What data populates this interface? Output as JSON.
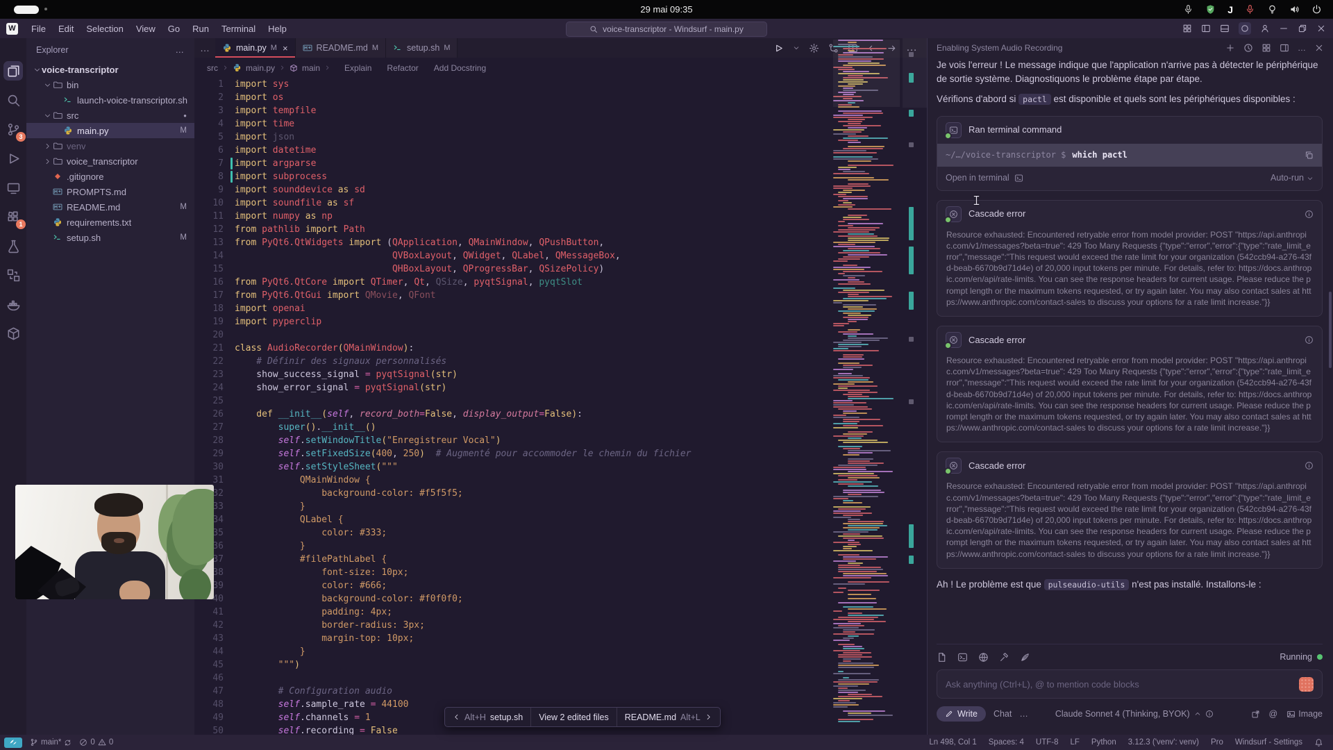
{
  "system_bar": {
    "clock": "29 mai 09:35",
    "tray_icons": [
      "mic",
      "shield",
      "jetbrains",
      "mic-recording",
      "bulb",
      "speaker",
      "power"
    ]
  },
  "menu_bar": {
    "logo": "W",
    "menus": [
      "File",
      "Edit",
      "Selection",
      "View",
      "Go",
      "Run",
      "Terminal",
      "Help"
    ],
    "search_title": "voice-transcriptor - Windsurf - main.py",
    "window_controls": [
      "grid",
      "panel-left",
      "panel-bottom",
      "circle",
      "account",
      "minimize",
      "restore",
      "close"
    ]
  },
  "activity_bar": {
    "items": [
      {
        "icon": "files",
        "active": true
      },
      {
        "icon": "search"
      },
      {
        "icon": "scm",
        "badge": "3"
      },
      {
        "icon": "debug"
      },
      {
        "icon": "devices"
      },
      {
        "icon": "extensions",
        "badge": "1"
      },
      {
        "icon": "flask"
      },
      {
        "icon": "boxes"
      },
      {
        "icon": "docker"
      },
      {
        "icon": "cube"
      }
    ]
  },
  "explorer": {
    "title": "Explorer",
    "items": [
      {
        "label": "voice-transcriptor",
        "level": 0,
        "chevron": "down",
        "root": true
      },
      {
        "label": "bin",
        "level": 1,
        "chevron": "down",
        "icon": "folder"
      },
      {
        "label": "launch-voice-transcriptor.sh",
        "level": 2,
        "icon": "shell"
      },
      {
        "label": "src",
        "level": 1,
        "chevron": "down",
        "icon": "folder",
        "badge": "dot"
      },
      {
        "label": "main.py",
        "level": 2,
        "icon": "python",
        "badge": "M",
        "selected": true
      },
      {
        "label": "venv",
        "level": 1,
        "chevron": "right",
        "icon": "folder",
        "dim": true
      },
      {
        "label": "voice_transcriptor",
        "level": 1,
        "chevron": "right",
        "icon": "folder"
      },
      {
        "label": ".gitignore",
        "level": 1,
        "icon": "git"
      },
      {
        "label": "PROMPTS.md",
        "level": 1,
        "icon": "markdown"
      },
      {
        "label": "README.md",
        "level": 1,
        "icon": "markdown",
        "badge": "M"
      },
      {
        "label": "requirements.txt",
        "level": 1,
        "icon": "python"
      },
      {
        "label": "setup.sh",
        "level": 1,
        "icon": "shell",
        "badge": "M"
      }
    ]
  },
  "tabs": [
    {
      "label": "main.py",
      "badge": "M",
      "icon": "python",
      "active": true,
      "closable": true
    },
    {
      "label": "README.md",
      "badge": "M",
      "icon": "markdown"
    },
    {
      "label": "setup.sh",
      "badge": "M",
      "icon": "shell"
    }
  ],
  "editor_actions": [
    "play",
    "chevdown",
    "gear",
    "diff",
    "split",
    "arrowl",
    "arrowr",
    "more"
  ],
  "breadcrumb": {
    "path": [
      "src",
      "main.py",
      "main"
    ],
    "actions": [
      "Explain",
      "Refactor",
      "Add Docstring"
    ]
  },
  "edited_files_bar": {
    "prev_shortcut": "Alt+H",
    "prev_file": "setup.sh",
    "center": "View 2 edited files",
    "next_file": "README.md",
    "next_shortcut": "Alt+L"
  },
  "editor": {
    "modified_lines": [
      7,
      8
    ],
    "lines": [
      {
        "n": 1,
        "s": [
          [
            "k",
            "import "
          ],
          [
            "m",
            "sys"
          ]
        ]
      },
      {
        "n": 2,
        "s": [
          [
            "k",
            "import "
          ],
          [
            "m",
            "os"
          ]
        ]
      },
      {
        "n": 3,
        "s": [
          [
            "k",
            "import "
          ],
          [
            "m",
            "tempfile"
          ]
        ]
      },
      {
        "n": 4,
        "s": [
          [
            "k",
            "import "
          ],
          [
            "m",
            "time"
          ]
        ]
      },
      {
        "n": 5,
        "s": [
          [
            "k",
            "import "
          ],
          [
            "d",
            "json"
          ]
        ]
      },
      {
        "n": 6,
        "s": [
          [
            "k",
            "import "
          ],
          [
            "m",
            "datetime"
          ]
        ]
      },
      {
        "n": 7,
        "s": [
          [
            "k",
            "import "
          ],
          [
            "m",
            "argparse"
          ]
        ]
      },
      {
        "n": 8,
        "s": [
          [
            "k",
            "import "
          ],
          [
            "m",
            "subprocess"
          ]
        ]
      },
      {
        "n": 9,
        "s": [
          [
            "k",
            "import "
          ],
          [
            "m",
            "sounddevice"
          ],
          [
            "k",
            " as "
          ],
          [
            "m",
            "sd"
          ]
        ]
      },
      {
        "n": 10,
        "s": [
          [
            "k",
            "import "
          ],
          [
            "m",
            "soundfile"
          ],
          [
            "k",
            " as "
          ],
          [
            "m",
            "sf"
          ]
        ]
      },
      {
        "n": 11,
        "s": [
          [
            "k",
            "import "
          ],
          [
            "m",
            "numpy"
          ],
          [
            "k",
            " as "
          ],
          [
            "m",
            "np"
          ]
        ]
      },
      {
        "n": 12,
        "s": [
          [
            "k",
            "from "
          ],
          [
            "m",
            "pathlib"
          ],
          [
            "k",
            " import "
          ],
          [
            "m",
            "Path"
          ]
        ]
      },
      {
        "n": 13,
        "s": [
          [
            "k",
            "from "
          ],
          [
            "m",
            "PyQt6.QtWidgets"
          ],
          [
            "k",
            " import "
          ],
          [
            "w",
            "("
          ],
          [
            "m",
            "QApplication"
          ],
          [
            "w",
            ", "
          ],
          [
            "m",
            "QMainWindow"
          ],
          [
            "w",
            ", "
          ],
          [
            "m",
            "QPushButton"
          ],
          [
            "w",
            ","
          ]
        ]
      },
      {
        "n": 14,
        "s": [
          [
            "w",
            "                             "
          ],
          [
            "m",
            "QVBoxLayout"
          ],
          [
            "w",
            ", "
          ],
          [
            "m",
            "QWidget"
          ],
          [
            "w",
            ", "
          ],
          [
            "m",
            "QLabel"
          ],
          [
            "w",
            ", "
          ],
          [
            "m",
            "QMessageBox"
          ],
          [
            "w",
            ","
          ]
        ]
      },
      {
        "n": 15,
        "s": [
          [
            "w",
            "                             "
          ],
          [
            "m",
            "QHBoxLayout"
          ],
          [
            "w",
            ", "
          ],
          [
            "m",
            "QProgressBar"
          ],
          [
            "w",
            ", "
          ],
          [
            "m",
            "QSizePolicy"
          ],
          [
            "w",
            ")"
          ]
        ]
      },
      {
        "n": 16,
        "s": [
          [
            "k",
            "from "
          ],
          [
            "m",
            "PyQt6.QtCore"
          ],
          [
            "k",
            " import "
          ],
          [
            "m",
            "QTimer"
          ],
          [
            "w",
            ", "
          ],
          [
            "m",
            "Qt"
          ],
          [
            "w",
            ", "
          ],
          [
            "d",
            "QSize"
          ],
          [
            "w",
            ", "
          ],
          [
            "m",
            "pyqtSignal"
          ],
          [
            "w",
            ", "
          ],
          [
            "dt",
            "pyqtSlot"
          ]
        ]
      },
      {
        "n": 17,
        "s": [
          [
            "k",
            "from "
          ],
          [
            "m",
            "PyQt6.QtGui"
          ],
          [
            "k",
            " import "
          ],
          [
            "dr",
            "QMovie"
          ],
          [
            "w",
            ", "
          ],
          [
            "dr",
            "QFont"
          ]
        ]
      },
      {
        "n": 18,
        "s": [
          [
            "k",
            "import "
          ],
          [
            "m",
            "openai"
          ]
        ]
      },
      {
        "n": 19,
        "s": [
          [
            "k",
            "import "
          ],
          [
            "m",
            "pyperclip"
          ]
        ]
      },
      {
        "n": 20,
        "s": []
      },
      {
        "n": 21,
        "s": [
          [
            "k",
            "class "
          ],
          [
            "m",
            "AudioRecorder"
          ],
          [
            "b",
            "("
          ],
          [
            "m",
            "QMainWindow"
          ],
          [
            "b",
            ")"
          ],
          [
            "w",
            ":"
          ]
        ]
      },
      {
        "n": 22,
        "s": [
          [
            "c",
            "    # Définir des signaux personnalisés"
          ]
        ]
      },
      {
        "n": 23,
        "s": [
          [
            "v",
            "    show_success_signal "
          ],
          [
            "o",
            "= "
          ],
          [
            "m",
            "pyqtSignal"
          ],
          [
            "b",
            "("
          ],
          [
            "y",
            "str"
          ],
          [
            "b",
            ")"
          ]
        ]
      },
      {
        "n": 24,
        "s": [
          [
            "v",
            "    show_error_signal "
          ],
          [
            "o",
            "= "
          ],
          [
            "m",
            "pyqtSignal"
          ],
          [
            "b",
            "("
          ],
          [
            "y",
            "str"
          ],
          [
            "b",
            ")"
          ]
        ]
      },
      {
        "n": 25,
        "s": []
      },
      {
        "n": 26,
        "s": [
          [
            "k",
            "    def "
          ],
          [
            "f",
            "__init__"
          ],
          [
            "b",
            "("
          ],
          [
            "sf",
            "self"
          ],
          [
            "w",
            ", "
          ],
          [
            "p",
            "record_both"
          ],
          [
            "o",
            "="
          ],
          [
            "y",
            "False"
          ],
          [
            "w",
            ", "
          ],
          [
            "p",
            "display_output"
          ],
          [
            "o",
            "="
          ],
          [
            "y",
            "False"
          ],
          [
            "b",
            ")"
          ],
          [
            "w",
            ":"
          ]
        ]
      },
      {
        "n": 27,
        "s": [
          [
            "w",
            "        "
          ],
          [
            "f",
            "super"
          ],
          [
            "b",
            "()"
          ],
          [
            "w",
            "."
          ],
          [
            "f",
            "__init__"
          ],
          [
            "b",
            "()"
          ]
        ]
      },
      {
        "n": 28,
        "s": [
          [
            "w",
            "        "
          ],
          [
            "sf",
            "self"
          ],
          [
            "w",
            "."
          ],
          [
            "f",
            "setWindowTitle"
          ],
          [
            "b",
            "("
          ],
          [
            "s",
            "\"Enregistreur Vocal\""
          ],
          [
            "b",
            ")"
          ]
        ]
      },
      {
        "n": 29,
        "s": [
          [
            "w",
            "        "
          ],
          [
            "sf",
            "self"
          ],
          [
            "w",
            "."
          ],
          [
            "f",
            "setFixedSize"
          ],
          [
            "b",
            "("
          ],
          [
            "n",
            "400"
          ],
          [
            "w",
            ", "
          ],
          [
            "n",
            "250"
          ],
          [
            "b",
            ")"
          ],
          [
            "c",
            "  # Augmenté pour accommoder le chemin du fichier"
          ]
        ]
      },
      {
        "n": 30,
        "s": [
          [
            "w",
            "        "
          ],
          [
            "sf",
            "self"
          ],
          [
            "w",
            "."
          ],
          [
            "f",
            "setStyleSheet"
          ],
          [
            "b",
            "("
          ],
          [
            "s",
            "\"\"\""
          ]
        ]
      },
      {
        "n": 31,
        "s": [
          [
            "s",
            "            QMainWindow {"
          ]
        ]
      },
      {
        "n": 32,
        "s": [
          [
            "s",
            "                background-color: #f5f5f5;"
          ]
        ]
      },
      {
        "n": 33,
        "s": [
          [
            "s",
            "            }"
          ]
        ]
      },
      {
        "n": 34,
        "s": [
          [
            "s",
            "            QLabel {"
          ]
        ]
      },
      {
        "n": 35,
        "s": [
          [
            "s",
            "                color: #333;"
          ]
        ]
      },
      {
        "n": 36,
        "s": [
          [
            "s",
            "            }"
          ]
        ]
      },
      {
        "n": 37,
        "s": [
          [
            "s",
            "            #filePathLabel {"
          ]
        ]
      },
      {
        "n": 38,
        "s": [
          [
            "s",
            "                font-size: 10px;"
          ]
        ]
      },
      {
        "n": 39,
        "s": [
          [
            "s",
            "                color: #666;"
          ]
        ]
      },
      {
        "n": 40,
        "s": [
          [
            "s",
            "                background-color: #f0f0f0;"
          ]
        ]
      },
      {
        "n": 41,
        "s": [
          [
            "s",
            "                padding: 4px;"
          ]
        ]
      },
      {
        "n": 42,
        "s": [
          [
            "s",
            "                border-radius: 3px;"
          ]
        ]
      },
      {
        "n": 43,
        "s": [
          [
            "s",
            "                margin-top: 10px;"
          ]
        ]
      },
      {
        "n": 44,
        "s": [
          [
            "s",
            "            }"
          ]
        ]
      },
      {
        "n": 45,
        "s": [
          [
            "s",
            "        \"\"\""
          ],
          [
            "b",
            ")"
          ]
        ]
      },
      {
        "n": 46,
        "s": []
      },
      {
        "n": 47,
        "s": [
          [
            "c",
            "        # Configuration audio"
          ]
        ]
      },
      {
        "n": 48,
        "s": [
          [
            "w",
            "        "
          ],
          [
            "sf",
            "self"
          ],
          [
            "w",
            "."
          ],
          [
            "v",
            "sample_rate"
          ],
          [
            "o",
            " = "
          ],
          [
            "n",
            "44100"
          ]
        ]
      },
      {
        "n": 49,
        "s": [
          [
            "w",
            "        "
          ],
          [
            "sf",
            "self"
          ],
          [
            "w",
            "."
          ],
          [
            "v",
            "channels"
          ],
          [
            "o",
            " = "
          ],
          [
            "n",
            "1"
          ]
        ]
      },
      {
        "n": 50,
        "s": [
          [
            "w",
            "        "
          ],
          [
            "sf",
            "self"
          ],
          [
            "w",
            "."
          ],
          [
            "v",
            "recording"
          ],
          [
            "o",
            " = "
          ],
          [
            "y",
            "False"
          ]
        ]
      }
    ]
  },
  "cascade": {
    "title": "Enabling System Audio Recording",
    "intro_1": "Je vois l'erreur ! Le message indique que l'application n'arrive pas à détecter le périphérique de sortie système. Diagnostiquons le problème étape par étape.",
    "intro_2_pre": "Vérifions d'abord si ",
    "intro_2_code": "pactl",
    "intro_2_post": " est disponible et quels sont les périphériques disponibles :",
    "command_card": {
      "title": "Ran terminal command",
      "prompt": "~/…/voice-transcriptor $",
      "command": "which pactl",
      "open_label": "Open in terminal",
      "autorun_label": "Auto-run"
    },
    "error_card_title": "Cascade error",
    "error_card_count": 3,
    "error_text": "Resource exhausted: Encountered retryable error from model provider: POST \"https://api.anthropic.com/v1/messages?beta=true\": 429 Too Many Requests {\"type\":\"error\",\"error\":{\"type\":\"rate_limit_error\",\"message\":\"This request would exceed the rate limit for your organization (542ccb94-a276-43fd-beab-6670b9d71d4e) of 20,000 input tokens per minute. For details, refer to: https://docs.anthropic.com/en/api/rate-limits. You can see the response headers for current usage. Please reduce the prompt length or the maximum tokens requested, or try again later. You may also contact sales at https://www.anthropic.com/contact-sales to discuss your options for a rate limit increase.\"}}",
    "outro_pre": "Ah ! Le problème est que ",
    "outro_code": "pulseaudio-utils",
    "outro_post": " n'est pas installé. Installons-le :",
    "running_label": "Running",
    "input_placeholder": "Ask anything (Ctrl+L), @ to mention code blocks",
    "footer": {
      "write": "Write",
      "chat": "Chat",
      "model": "Claude Sonnet 4 (Thinking, BYOK)",
      "image": "Image"
    }
  },
  "status_bar": {
    "branch": "main*",
    "errors": "0",
    "warnings": "0",
    "right_items": [
      "Ln 498, Col 1",
      "Spaces: 4",
      "UTF-8",
      "LF",
      "Python",
      "3.12.3 ('venv': venv)",
      "Pro",
      "Windsurf - Settings"
    ]
  }
}
